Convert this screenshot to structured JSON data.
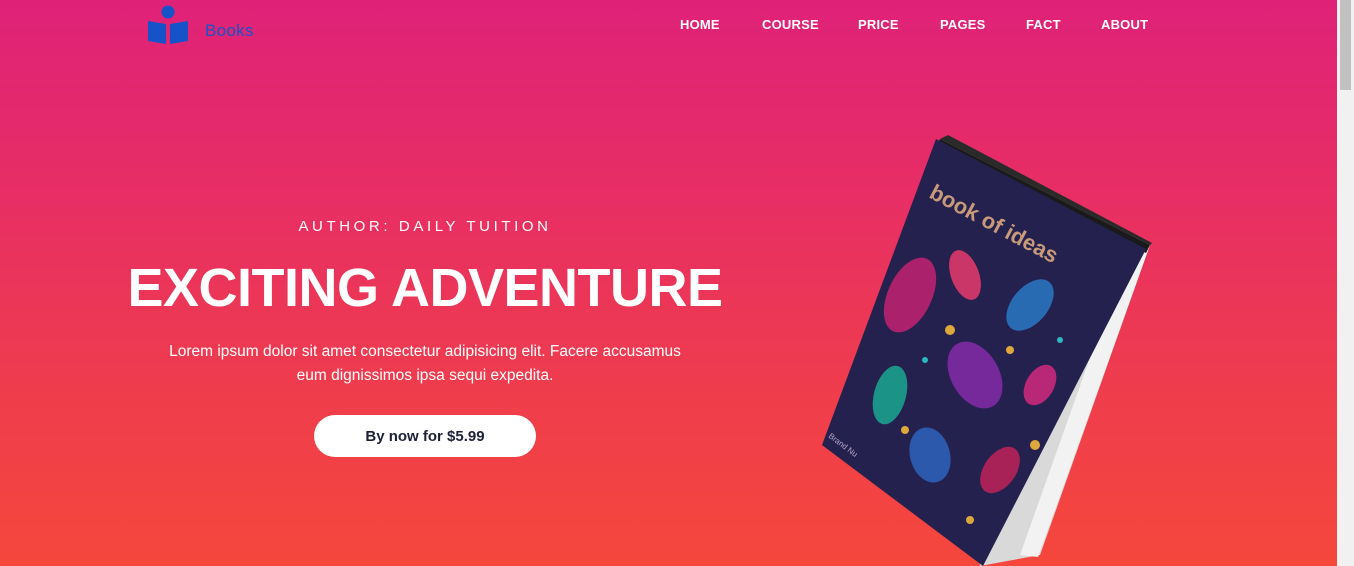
{
  "brand": {
    "name": "Books",
    "logo_icon": "book-reader-icon",
    "logo_color": "#1753c8"
  },
  "nav": {
    "items": [
      {
        "label": "HOME"
      },
      {
        "label": "COURSE"
      },
      {
        "label": "PRICE"
      },
      {
        "label": "PAGES"
      },
      {
        "label": "FACT"
      },
      {
        "label": "ABOUT"
      }
    ]
  },
  "hero": {
    "author": "AUTHOR: DAILY TUITION",
    "title": "EXCITING ADVENTURE",
    "description_line1": "Lorem ipsum dolor sit amet consectetur adipisicing elit. Facere accusamus",
    "description_line2": "eum dignissimos ipsa sequi expedita.",
    "cta_label": "By now for $5.99",
    "gradient_top": "#df2278",
    "gradient_bottom": "#f5473c"
  },
  "book": {
    "title": "book of ideas",
    "brand": "Brand Nu",
    "cover_color": "#24214f"
  }
}
